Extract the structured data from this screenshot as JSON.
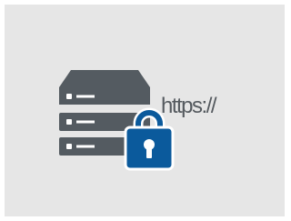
{
  "image": {
    "icon": "server-with-padlock-icon",
    "secure_url_text": "https://"
  },
  "colors": {
    "background": "#e6e6e6",
    "border": "#ffffff",
    "server": "#545b61",
    "server_detail": "#ffffff",
    "lock": "#0b5a9c",
    "lock_outline": "#ffffff",
    "text": "#555a5f"
  }
}
